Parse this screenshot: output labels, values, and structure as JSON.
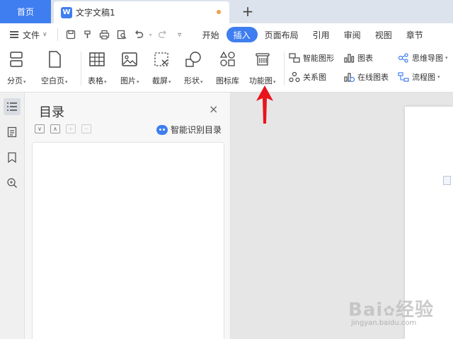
{
  "tabbar": {
    "home_label": "首页",
    "doc_logo": "W",
    "doc_title": "文字文稿1",
    "new_tab": "+"
  },
  "menubar": {
    "file_label": "文件",
    "tabs": [
      "开始",
      "插入",
      "页面布局",
      "引用",
      "审阅",
      "视图",
      "章节"
    ],
    "active_tab": "插入"
  },
  "ribbon": {
    "page_break": "分页",
    "blank_page": "空白页",
    "table": "表格",
    "picture": "图片",
    "screenshot": "截屏",
    "shape": "形状",
    "icon_library": "图标库",
    "function_chart": "功能图",
    "smart_art": "智能图形",
    "chart": "图表",
    "mind_map": "思维导图",
    "relation_chart": "关系图",
    "online_chart": "在线图表",
    "flow_chart": "流程图"
  },
  "toc": {
    "title": "目录",
    "close": "×",
    "smart_detect": "智能识别目录"
  },
  "watermark": {
    "brand": "Bai",
    "brand_cn": "经验",
    "url": "jingyan.baidu.com"
  },
  "colors": {
    "accent": "#3f7ef0",
    "arrow": "#e8141b"
  }
}
